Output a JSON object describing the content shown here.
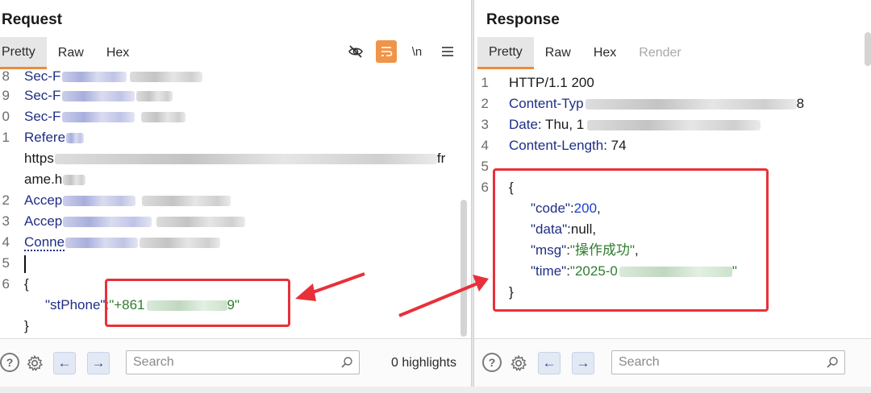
{
  "request": {
    "title": "Request",
    "tabs": [
      "Pretty",
      "Raw",
      "Hex"
    ],
    "active_tab": "Pretty",
    "toolbar": {
      "hide_icon": "eye-off-icon",
      "wrap_icon": "wrap-lines-icon",
      "newline_label": "\\n",
      "menu_icon": "hamburger-menu-icon"
    },
    "lines": [
      {
        "num": "8",
        "key": "Sec-F",
        "text": ""
      },
      {
        "num": "9",
        "key": "Sec-F",
        "text": ""
      },
      {
        "num": "0",
        "key": "Sec-F",
        "text": ""
      },
      {
        "num": "1",
        "key": "Refere",
        "text": ""
      },
      {
        "num": "",
        "key": "",
        "text": "https",
        "tail": "fr"
      },
      {
        "num": "",
        "key": "",
        "text": "ame.h"
      },
      {
        "num": "2",
        "key": "Accep",
        "text": ""
      },
      {
        "num": "3",
        "key": "Accep",
        "text": ""
      },
      {
        "num": "4",
        "key": "Conne",
        "text": ""
      },
      {
        "num": "5",
        "key": "",
        "text": ""
      },
      {
        "num": "6",
        "key": "",
        "text": "{"
      },
      {
        "num": "",
        "key": "\"stPhone\"",
        "text": ":",
        "value_prefix": "\"+861",
        "value_suffix": "9\""
      },
      {
        "num": "",
        "key": "",
        "text": "}"
      }
    ],
    "bottom": {
      "help_icon": "help-icon",
      "settings_icon": "gear-icon",
      "back_label": "←",
      "forward_label": "→",
      "search_placeholder": "Search",
      "highlights": "0 highlights"
    }
  },
  "response": {
    "title": "Response",
    "tabs": [
      "Pretty",
      "Raw",
      "Hex",
      "Render"
    ],
    "active_tab": "Pretty",
    "lines": [
      {
        "num": "1",
        "key": "HTTP/1.1 200",
        "text": ""
      },
      {
        "num": "2",
        "key": "Content-Typ",
        "text": "",
        "tail": "8"
      },
      {
        "num": "3",
        "key": "Date",
        "text": ": Thu, 1"
      },
      {
        "num": "4",
        "key": "Content-Length",
        "text": ": 74"
      },
      {
        "num": "5",
        "key": "",
        "text": ""
      },
      {
        "num": "6",
        "key": "",
        "text": "{"
      },
      {
        "num": "",
        "key": "\"code\"",
        "text": ":",
        "value": "200",
        "end": ","
      },
      {
        "num": "",
        "key": "\"data\"",
        "text": ":null,"
      },
      {
        "num": "",
        "key": "\"msg\"",
        "text": ":",
        "value": "\"操作成功\"",
        "end": ","
      },
      {
        "num": "",
        "key": "\"time\"",
        "text": ":",
        "value_prefix": "\"2025-0",
        "value_suffix": "\""
      },
      {
        "num": "",
        "key": "",
        "text": "}"
      }
    ],
    "bottom": {
      "help_icon": "help-icon",
      "settings_icon": "gear-icon",
      "back_label": "←",
      "forward_label": "→",
      "search_placeholder": "Search"
    }
  },
  "colors": {
    "accent": "#f08a3a",
    "highlight_box": "#e8303a",
    "header_key": "#1f2e86",
    "json_string": "#2f7d2f",
    "json_number": "#1a3fcf"
  }
}
